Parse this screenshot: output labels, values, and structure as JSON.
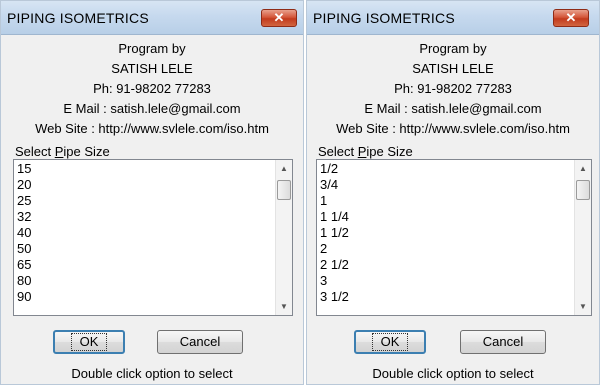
{
  "dialogs": [
    {
      "title": "PIPING ISOMETRICS",
      "close_label": "✕",
      "program_by": "Program by",
      "author": "SATISH LELE",
      "phone": "Ph: 91-98202 77283",
      "email": "E Mail : satish.lele@gmail.com",
      "website": "Web Site : http://www.svlele.com/iso.htm",
      "select_label_pre": "Select ",
      "select_label_ul": "P",
      "select_label_post": "ipe Size",
      "items": [
        "15",
        "20",
        "25",
        "32",
        "40",
        "50",
        "65",
        "80",
        "90"
      ],
      "ok_label": "OK",
      "cancel_label": "Cancel",
      "hint": "Double click option to select"
    },
    {
      "title": "PIPING ISOMETRICS",
      "close_label": "✕",
      "program_by": "Program by",
      "author": "SATISH LELE",
      "phone": "Ph: 91-98202 77283",
      "email": "E Mail : satish.lele@gmail.com",
      "website": "Web Site : http://www.svlele.com/iso.htm",
      "select_label_pre": "Select ",
      "select_label_ul": "P",
      "select_label_post": "ipe Size",
      "items": [
        "1/2",
        "3/4",
        "1",
        "1 1/4",
        "1 1/2",
        "2",
        "2 1/2",
        "3",
        "3 1/2"
      ],
      "ok_label": "OK",
      "cancel_label": "Cancel",
      "hint": "Double click option to select"
    }
  ],
  "icons": {
    "scroll_up": "scroll-up-arrow-icon",
    "scroll_down": "scroll-down-arrow-icon",
    "close": "close-icon"
  },
  "colors": {
    "titlebar": "#c6d9ee",
    "close_button": "#c23b1e",
    "dialog_bg": "#f0f0f0",
    "default_button_border": "#3c7fb1"
  }
}
